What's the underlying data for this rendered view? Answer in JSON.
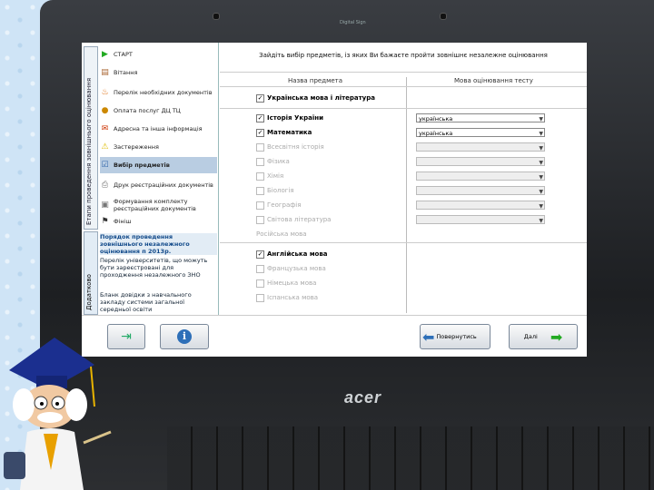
{
  "brand_top": "Digital Sign",
  "laptop_brand": "acer",
  "sidebar": {
    "vtab1": "Етапи проведення зовнішнього оцінювання",
    "vtab2": "Додатково",
    "items": [
      {
        "label": "СТАРТ",
        "icon": "play-icon"
      },
      {
        "label": "Вітання",
        "icon": "document-icon"
      },
      {
        "label": "Перелік необхідних документів",
        "icon": "flame-icon"
      },
      {
        "label": "Оплата послуг ДЦ ТЦ",
        "icon": "coin-icon"
      },
      {
        "label": "Адресна та інша інформація",
        "icon": "mail-icon"
      },
      {
        "label": "Застереження",
        "icon": "warning-icon"
      },
      {
        "label": "Вибір предметів",
        "icon": "check-icon"
      },
      {
        "label": "Друк реєстраційних документів",
        "icon": "printer-icon"
      },
      {
        "label": "Формування комплекту реєстраційних документів",
        "icon": "folder-icon"
      },
      {
        "label": "Фініш",
        "icon": "flag-icon"
      }
    ],
    "links": [
      "Порядок проведення зовнішнього незалежного оцінювання  п 2013р.",
      "Перелік університетів, що можуть бути зареєстровані для проходження незалежного ЗНО",
      "Бланк довідки з навчального закладу системи загальної середньої освіти"
    ]
  },
  "main": {
    "header": "Зайдіть вибір предметів, із яких Ви бажаєте пройти зовнішнє незалежне оцінювання",
    "col_subject": "Назва предмета",
    "col_language": "Мова оцінювання тесту",
    "subjects": [
      {
        "name": "Українська мова і література",
        "checked": true,
        "enabled": true,
        "language": ""
      },
      {
        "name": "Історія України",
        "checked": true,
        "enabled": true,
        "language": "українська"
      },
      {
        "name": "Математика",
        "checked": true,
        "enabled": true,
        "language": "українська"
      },
      {
        "name": "Всесвітня історія",
        "checked": false,
        "enabled": false,
        "language": ""
      },
      {
        "name": "Фізика",
        "checked": false,
        "enabled": false,
        "language": ""
      },
      {
        "name": "Хімія",
        "checked": false,
        "enabled": false,
        "language": ""
      },
      {
        "name": "Біологія",
        "checked": false,
        "enabled": false,
        "language": ""
      },
      {
        "name": "Географія",
        "checked": false,
        "enabled": false,
        "language": ""
      },
      {
        "name": "Світова література",
        "checked": false,
        "enabled": false,
        "language": ""
      },
      {
        "name": "Російська мова",
        "checked": false,
        "enabled": false,
        "language": ""
      },
      {
        "name": "Англійська мова",
        "checked": true,
        "enabled": true,
        "language": ""
      },
      {
        "name": "Французька мова",
        "checked": false,
        "enabled": false,
        "language": ""
      },
      {
        "name": "Німецька мова",
        "checked": false,
        "enabled": false,
        "language": ""
      },
      {
        "name": "Іспанська мова",
        "checked": false,
        "enabled": false,
        "language": ""
      }
    ]
  },
  "buttons": {
    "back": "Повернутись",
    "next": "Далі"
  }
}
